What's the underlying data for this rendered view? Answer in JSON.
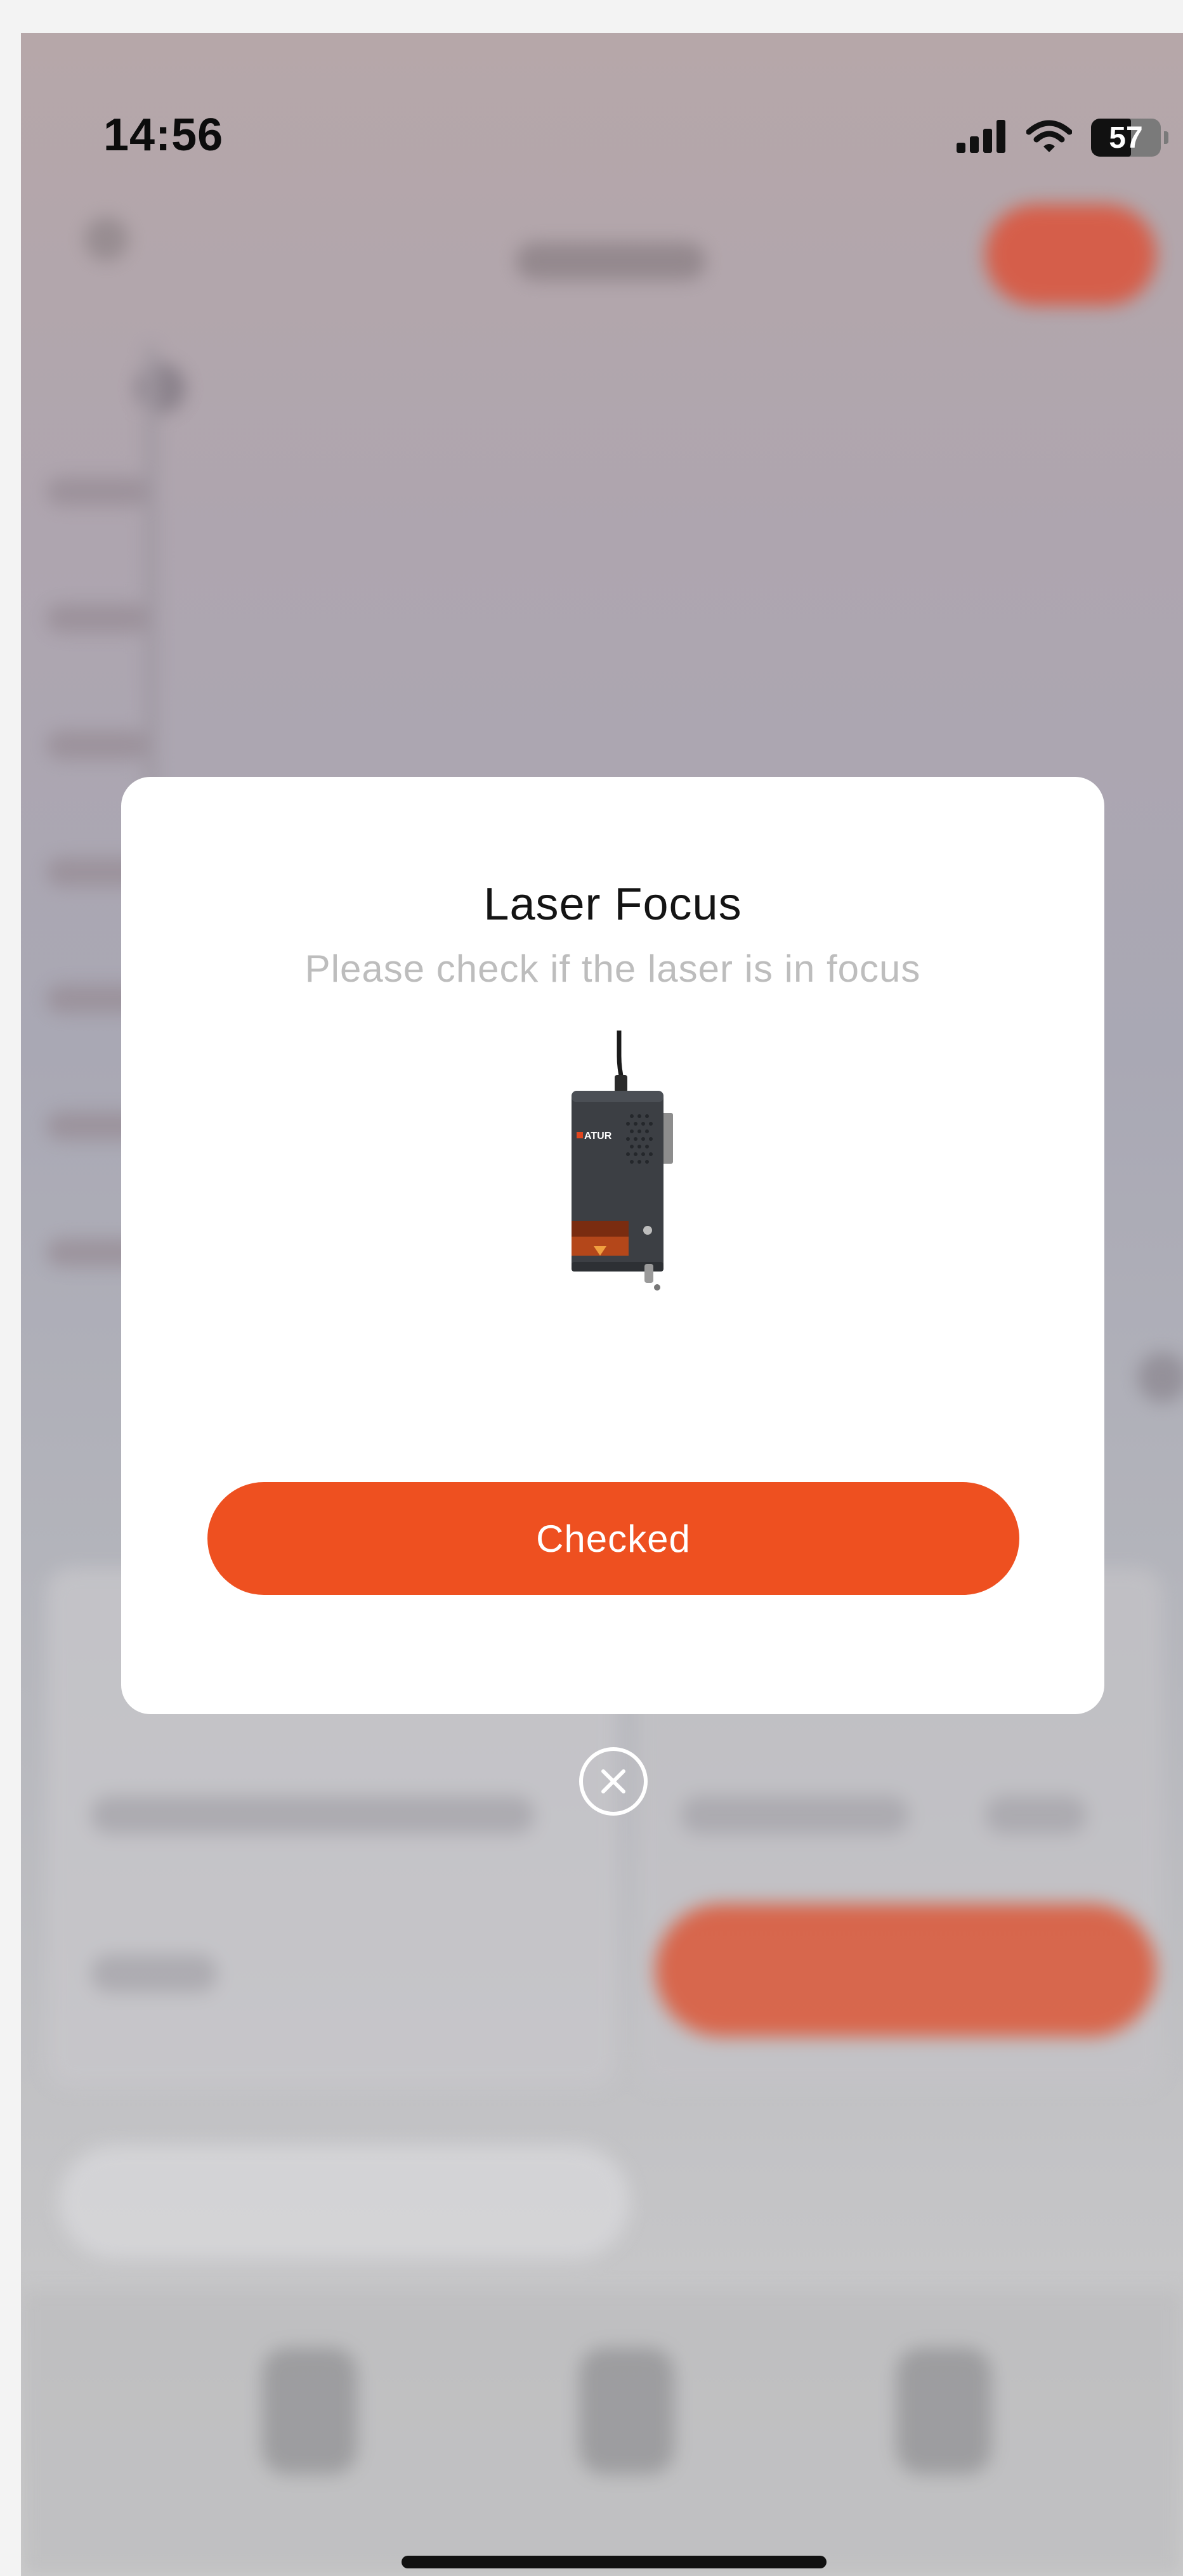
{
  "status_bar": {
    "time": "14:56",
    "battery_level": "57",
    "icons": [
      "cellular-signal-icon",
      "wifi-icon",
      "battery-icon"
    ]
  },
  "dialog": {
    "title": "Laser Focus",
    "subtitle": "Please check if the laser is in focus",
    "image": "laser-module-image",
    "image_brand_text": "ATUR",
    "confirm_label": "Checked",
    "close_icon": "close-circle-icon"
  },
  "colors": {
    "accent": "#EE5020",
    "dialog_background": "#FFFFFF",
    "title_text": "#141414",
    "subtitle_text": "#BDBDBD"
  }
}
